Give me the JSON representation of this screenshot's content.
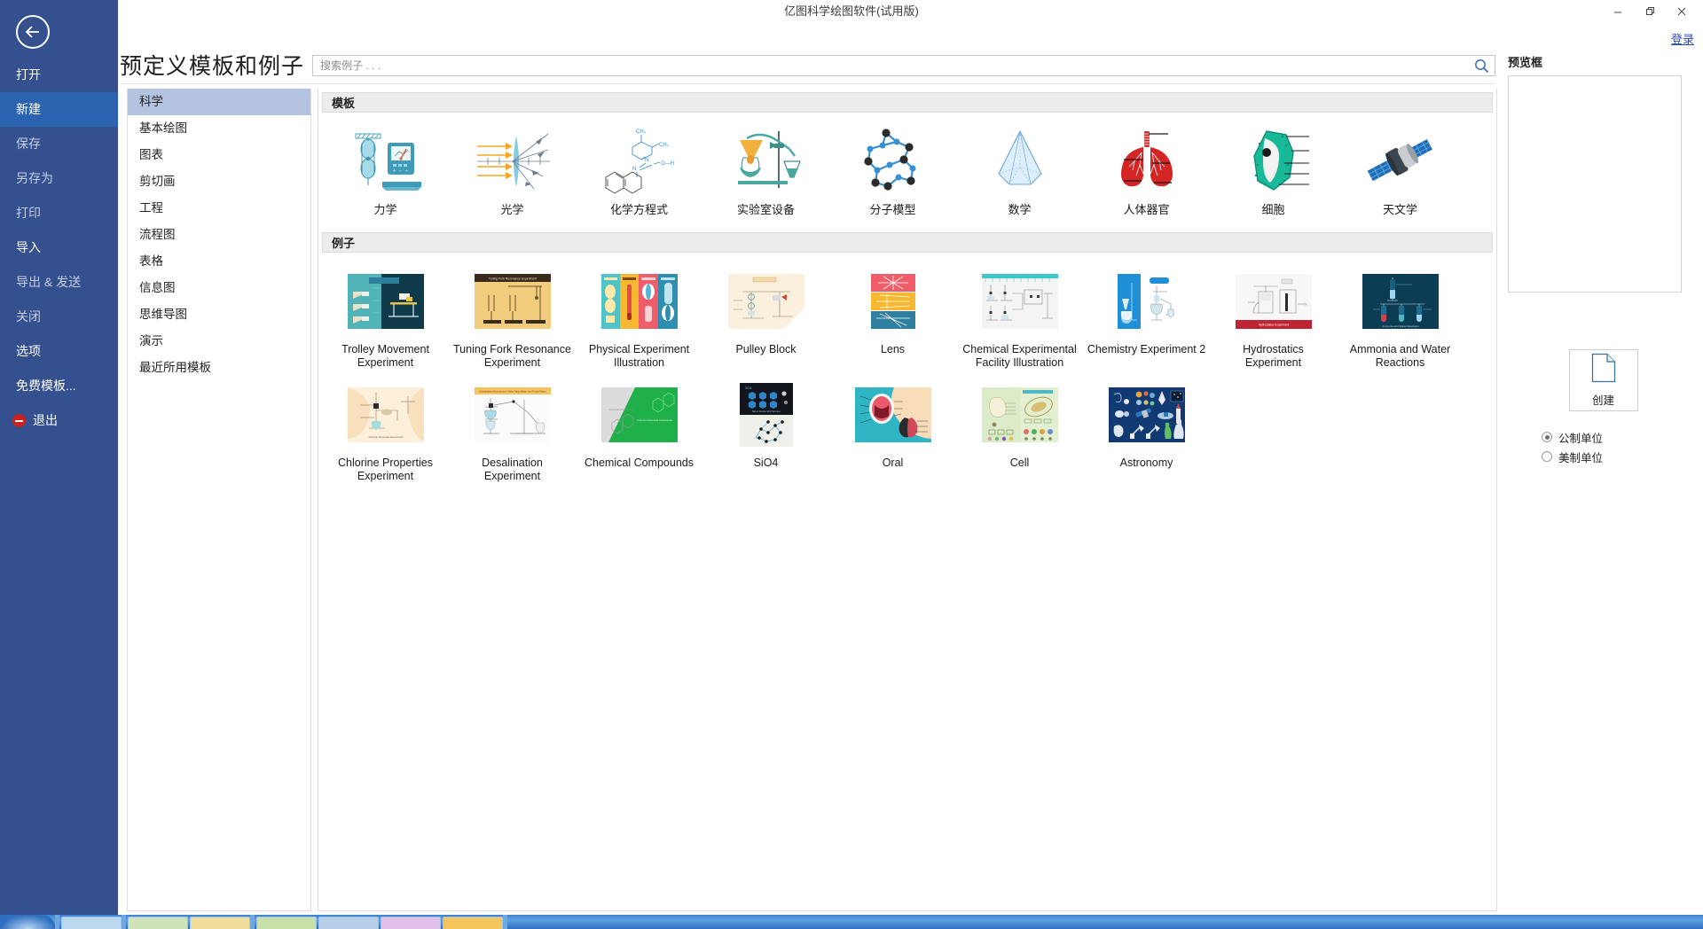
{
  "window": {
    "title": "亿图科学绘图软件(试用版)",
    "minimize_label": "—",
    "maximize_label": "❐",
    "close_label": "✕",
    "login_label": "登录"
  },
  "sidebar": {
    "back_icon": "back-arrow-icon",
    "items": [
      {
        "label": "打开",
        "state": "enabled"
      },
      {
        "label": "新建",
        "state": "active"
      },
      {
        "label": "保存",
        "state": "disabled"
      },
      {
        "label": "另存为",
        "state": "disabled"
      },
      {
        "label": "打印",
        "state": "disabled"
      },
      {
        "label": "导入",
        "state": "enabled"
      },
      {
        "label": "导出 & 发送",
        "state": "disabled"
      },
      {
        "label": "关闭",
        "state": "disabled"
      },
      {
        "label": "选项",
        "state": "enabled"
      },
      {
        "label": "免费模板...",
        "state": "enabled"
      },
      {
        "label": "退出",
        "state": "enabled",
        "icon": "exit-icon"
      }
    ]
  },
  "header": {
    "page_title": "预定义模板和例子"
  },
  "search": {
    "placeholder": "搜索例子 . . .",
    "value": "",
    "icon": "search-icon",
    "icon_color": "#3a6fbe"
  },
  "categories": {
    "selected": "科学",
    "items": [
      "科学",
      "基本绘图",
      "图表",
      "剪切画",
      "工程",
      "流程图",
      "表格",
      "信息图",
      "思维导图",
      "演示",
      "最近所用模板"
    ]
  },
  "templates_section": {
    "header": "模板",
    "items": [
      {
        "label": "力学",
        "icon": "mechanics-pulley-icon"
      },
      {
        "label": "光学",
        "icon": "optics-lens-icon"
      },
      {
        "label": "化学方程式",
        "icon": "chemical-formula-icon"
      },
      {
        "label": "实验室设备",
        "icon": "lab-equipment-icon"
      },
      {
        "label": "分子模型",
        "icon": "molecular-model-icon"
      },
      {
        "label": "数学",
        "icon": "math-pyramid-icon"
      },
      {
        "label": "人体器官",
        "icon": "human-lungs-icon"
      },
      {
        "label": "细胞",
        "icon": "cell-icon"
      },
      {
        "label": "天文学",
        "icon": "astronomy-satellite-icon"
      }
    ]
  },
  "examples_section": {
    "header": "例子",
    "items": [
      {
        "label": "Trolley Movement Experiment",
        "thumb": "trolley-movement-thumb"
      },
      {
        "label": "Tuning Fork Resonance Experiment",
        "thumb": "tuning-fork-thumb"
      },
      {
        "label": "Physical Experiment Illustration",
        "thumb": "physical-experiment-thumb"
      },
      {
        "label": "Pulley Block",
        "thumb": "pulley-block-thumb"
      },
      {
        "label": "Lens",
        "thumb": "lens-thumb"
      },
      {
        "label": "Chemical Experimental Facility Illustration",
        "thumb": "chemical-facility-thumb"
      },
      {
        "label": "Chemistry Experiment 2",
        "thumb": "chemistry-experiment-2-thumb"
      },
      {
        "label": "Hydrostatics Experiment",
        "thumb": "hydrostatics-thumb"
      },
      {
        "label": "Ammonia and Water Reactions",
        "thumb": "ammonia-water-thumb"
      },
      {
        "label": "Chlorine Properties Experiment",
        "thumb": "chlorine-properties-thumb"
      },
      {
        "label": "Desalination Experiment",
        "thumb": "desalination-thumb"
      },
      {
        "label": "Chemical Compounds",
        "thumb": "chemical-compounds-thumb"
      },
      {
        "label": "SiO4",
        "thumb": "sio4-thumb"
      },
      {
        "label": "Oral",
        "thumb": "oral-thumb"
      },
      {
        "label": "Cell",
        "thumb": "cell-thumb"
      },
      {
        "label": "Astronomy",
        "thumb": "astronomy-thumb"
      }
    ]
  },
  "preview": {
    "title": "预览框",
    "create_label": "创建",
    "create_icon": "document-page-icon",
    "units": [
      {
        "label": "公制单位",
        "selected": true
      },
      {
        "label": "美制单位",
        "selected": false
      }
    ]
  },
  "colors": {
    "sidebar_bg": "#34508f",
    "sidebar_active": "#2b63b0",
    "category_selected": "#b4c3e0",
    "section_header_bg": "#ececec",
    "link": "#2b49b5",
    "exit_red": "#cc2121"
  }
}
